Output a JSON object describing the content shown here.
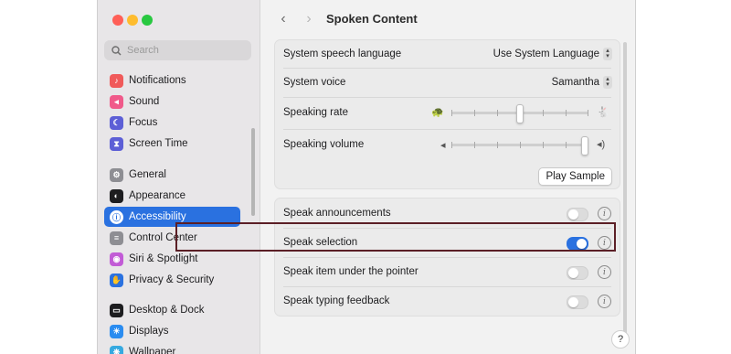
{
  "search": {
    "placeholder": "Search"
  },
  "sidebar": {
    "items": [
      {
        "label": "Notifications",
        "icon": "bell-icon",
        "color": "#f05a5a"
      },
      {
        "label": "Sound",
        "icon": "speaker-icon",
        "color": "#f05a8a"
      },
      {
        "label": "Focus",
        "icon": "moon-icon",
        "color": "#5d5fd6"
      },
      {
        "label": "Screen Time",
        "icon": "hourglass-icon",
        "color": "#5d5fd6"
      },
      {
        "label": "General",
        "icon": "gear-icon",
        "color": "#8e8e93"
      },
      {
        "label": "Appearance",
        "icon": "appearance-icon",
        "color": "#1d1d1f"
      },
      {
        "label": "Accessibility",
        "icon": "accessibility-icon",
        "color": "#2a71e0"
      },
      {
        "label": "Control Center",
        "icon": "control-center-icon",
        "color": "#8e8e93"
      },
      {
        "label": "Siri & Spotlight",
        "icon": "siri-icon",
        "color": "#c25bd6"
      },
      {
        "label": "Privacy & Security",
        "icon": "hand-icon",
        "color": "#2a71e0"
      },
      {
        "label": "Desktop & Dock",
        "icon": "dock-icon",
        "color": "#1d1d1f"
      },
      {
        "label": "Displays",
        "icon": "sun-icon",
        "color": "#2a8cf0"
      },
      {
        "label": "Wallpaper",
        "icon": "wallpaper-icon",
        "color": "#36a9e0"
      }
    ]
  },
  "header": {
    "title": "Spoken Content",
    "back": "‹",
    "forward": "›"
  },
  "speech": {
    "language_label": "System speech language",
    "language_value": "Use System Language",
    "voice_label": "System voice",
    "voice_value": "Samantha",
    "rate_label": "Speaking rate",
    "rate_level": 0.5,
    "volume_label": "Speaking volume",
    "volume_level": 0.97,
    "play_sample": "Play Sample"
  },
  "options": [
    {
      "label": "Speak announcements",
      "on": false
    },
    {
      "label": "Speak selection",
      "on": true
    },
    {
      "label": "Speak item under the pointer",
      "on": false
    },
    {
      "label": "Speak typing feedback",
      "on": false
    }
  ],
  "help": "?",
  "colors": {
    "accent": "#2a71e0",
    "highlight_border": "#5b1f26"
  }
}
